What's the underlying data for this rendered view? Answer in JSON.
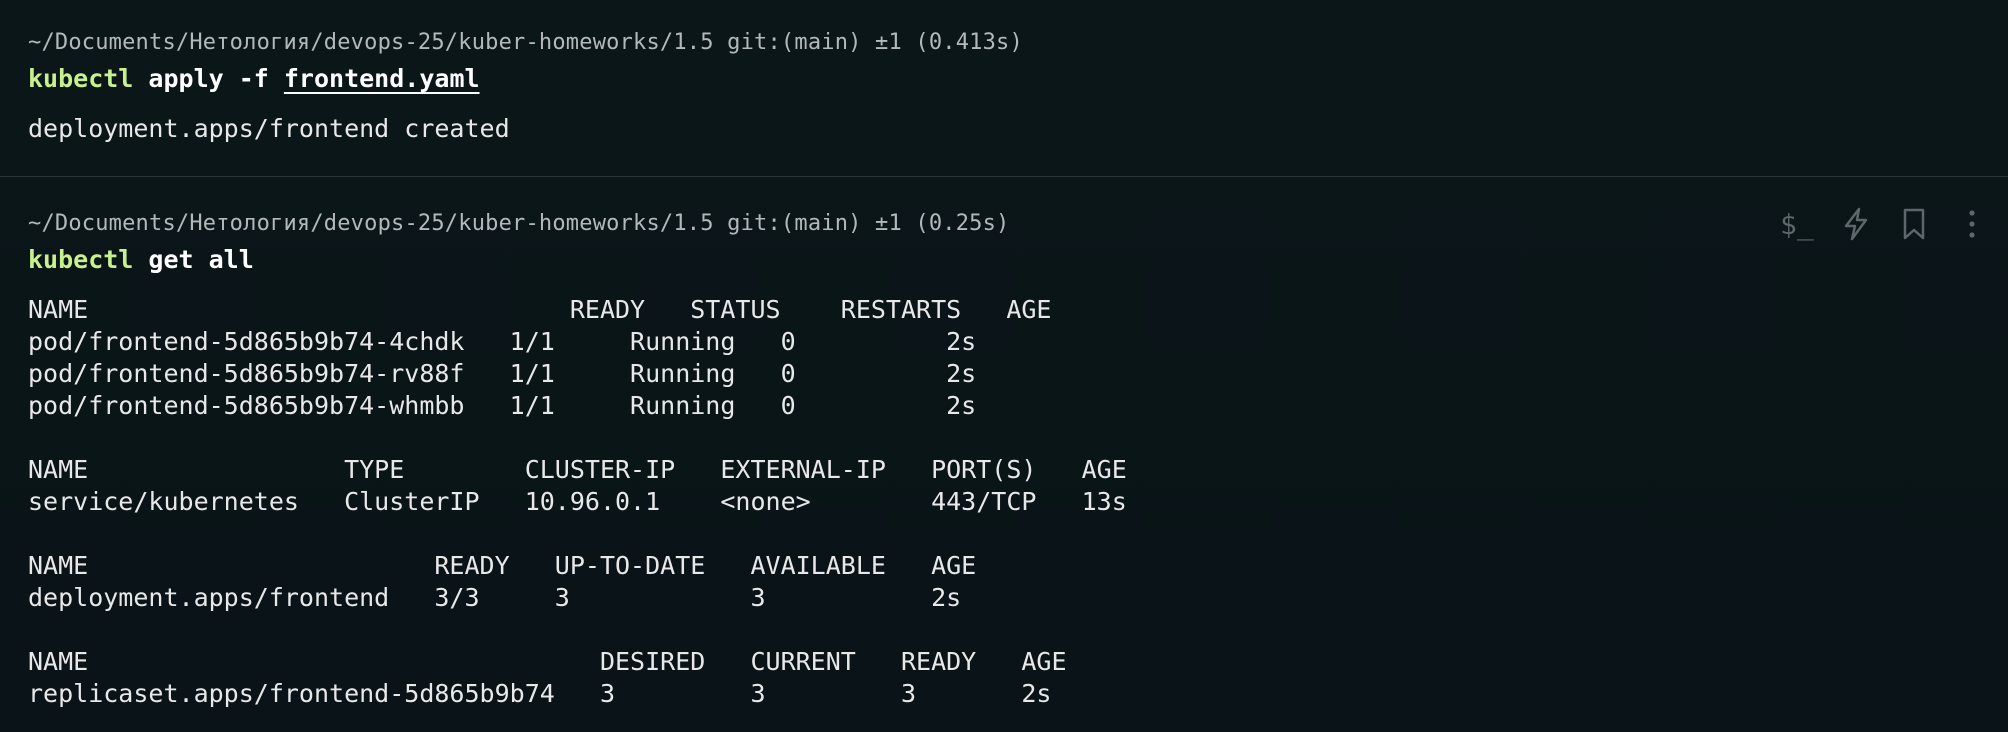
{
  "blocks": [
    {
      "prompt": "~/Documents/Нетология/devops-25/kuber-homeworks/1.5 git:(main) ±1 (0.413s)",
      "command": {
        "bin": "kubectl",
        "args_before": " apply -f ",
        "file": "frontend.yaml"
      },
      "output": "deployment.apps/frontend created"
    },
    {
      "prompt": "~/Documents/Нетология/devops-25/kuber-homeworks/1.5 git:(main) ±1 (0.25s)",
      "command": {
        "bin": "kubectl",
        "args": " get all"
      },
      "output": "NAME                                READY   STATUS    RESTARTS   AGE\npod/frontend-5d865b9b74-4chdk   1/1     Running   0          2s\npod/frontend-5d865b9b74-rv88f   1/1     Running   0          2s\npod/frontend-5d865b9b74-whmbb   1/1     Running   0          2s\n\nNAME                 TYPE        CLUSTER-IP   EXTERNAL-IP   PORT(S)   AGE\nservice/kubernetes   ClusterIP   10.96.0.1    <none>        443/TCP   13s\n\nNAME                       READY   UP-TO-DATE   AVAILABLE   AGE\ndeployment.apps/frontend   3/3     3            3           2s\n\nNAME                                  DESIRED   CURRENT   READY   AGE\nreplicaset.apps/frontend-5d865b9b74   3         3         3       2s",
      "toolbar": [
        {
          "name": "terminal-prompt-icon"
        },
        {
          "name": "lightning-icon"
        },
        {
          "name": "bookmark-icon"
        },
        {
          "name": "more-vertical-icon"
        }
      ]
    }
  ],
  "colors": {
    "background": "#0b1519",
    "command_bin": "#c8f08f",
    "prompt": "#b3b9bb",
    "text": "#e8e8e8",
    "icon": "#5d676b"
  }
}
